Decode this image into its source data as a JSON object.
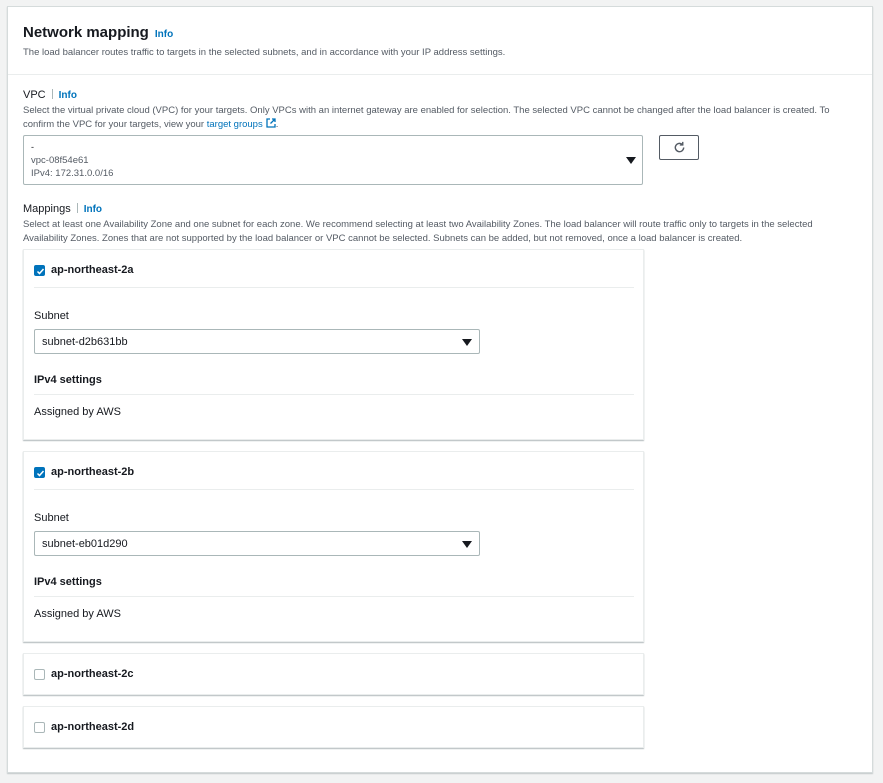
{
  "section": {
    "title": "Network mapping",
    "info": "Info",
    "description": "The load balancer routes traffic to targets in the selected subnets, and in accordance with your IP address settings."
  },
  "vpc": {
    "label": "VPC",
    "info": "Info",
    "description_line1": "Select the virtual private cloud (VPC) for your targets. Only VPCs with an internet gateway are enabled for selection. The selected VPC cannot be changed after the load balancer is created. To",
    "description_line2_prefix": "confirm the VPC for your targets, view your ",
    "description_link": "target groups",
    "description_suffix": ".",
    "selected_name": "-",
    "selected_id": "vpc-08f54e61",
    "selected_cidr": "IPv4: 172.31.0.0/16"
  },
  "mappings": {
    "label": "Mappings",
    "info": "Info",
    "description_line1": "Select at least one Availability Zone and one subnet for each zone. We recommend selecting at least two Availability Zones. The load balancer will route traffic only to targets in the selected",
    "description_line2": "Availability Zones. Zones that are not supported by the load balancer or VPC cannot be selected. Subnets can be added, but not removed, once a load balancer is created.",
    "zones": [
      {
        "name": "ap-northeast-2a",
        "checked": true,
        "subnet_label": "Subnet",
        "subnet_value": "subnet-d2b631bb",
        "ipv4_title": "IPv4 settings",
        "ipv4_value": "Assigned by AWS"
      },
      {
        "name": "ap-northeast-2b",
        "checked": true,
        "subnet_label": "Subnet",
        "subnet_value": "subnet-eb01d290",
        "ipv4_title": "IPv4 settings",
        "ipv4_value": "Assigned by AWS"
      },
      {
        "name": "ap-northeast-2c",
        "checked": false
      },
      {
        "name": "ap-northeast-2d",
        "checked": false
      }
    ]
  },
  "icons": {
    "refresh": "refresh-icon",
    "external_link": "external-link-icon",
    "caret": "caret-down-icon",
    "check": "check-icon"
  },
  "colors": {
    "accent": "#0073bb",
    "text": "#16191f",
    "secondary_text": "#545b64",
    "border": "#aab7b8"
  }
}
